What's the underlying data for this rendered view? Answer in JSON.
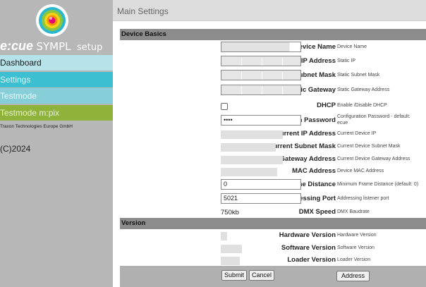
{
  "sidebar": {
    "brand_ecue": "e:cue",
    "brand_sympl": "SYMPL",
    "brand_setup": "setup",
    "nav": [
      {
        "label": "Dashboard"
      },
      {
        "label": "Settings"
      },
      {
        "label": "Testmode"
      },
      {
        "label": "Testmode m:pix"
      }
    ],
    "company": "Traxon Technologies Europe GmbH",
    "copyright": "(C)2024"
  },
  "header": {
    "title": "Main Settings"
  },
  "sections": {
    "device_basics": "Device Basics",
    "version": "Version"
  },
  "rows": {
    "device_name": {
      "label": "Device Name",
      "desc": "Device Name"
    },
    "static_ip": {
      "label": "Static IP Address",
      "desc": "Static IP"
    },
    "static_subnet": {
      "label": "Static Subnet Mask",
      "desc": "Static Subnet Mask"
    },
    "static_gateway": {
      "label": "Static Gateway",
      "desc": "Static Gateway Address"
    },
    "dhcp": {
      "label": "DHCP",
      "desc": "Enable /Disable DHCP"
    },
    "config_password": {
      "label": "Configuration Password",
      "value": "••••",
      "desc_line1": "Configuration Password - default:",
      "desc_line2": "ecue"
    },
    "current_ip": {
      "label": "Current IP Address",
      "desc": "Current Device IP"
    },
    "current_subnet": {
      "label": "Current Subnet Mask",
      "desc": "Current Device Subnet Mask"
    },
    "current_gateway": {
      "label": "Current Gateway Address",
      "desc": "Current Device Gateway Address"
    },
    "mac": {
      "label": "MAC Address",
      "desc": "Device MAC Address"
    },
    "min_frame": {
      "label": "Minimum Frame Distance",
      "value": "0",
      "desc": "Minimum Frame Distance (default: 0)"
    },
    "addr_port": {
      "label": "Addressing Port",
      "value": "5021",
      "desc": "Addressing listener port"
    },
    "dmx_speed": {
      "label": "DMX Speed",
      "value": "750kb",
      "desc": "DMX Baudrate"
    },
    "hw_version": {
      "label": "Hardware Version",
      "desc": "Hardware Version"
    },
    "sw_version": {
      "label": "Software Version",
      "desc": "Software Version"
    },
    "loader_version": {
      "label": "Loader Version",
      "desc": "Loader Version"
    }
  },
  "buttons": {
    "submit": "Submit",
    "cancel": "Cancel",
    "address": "Address"
  }
}
